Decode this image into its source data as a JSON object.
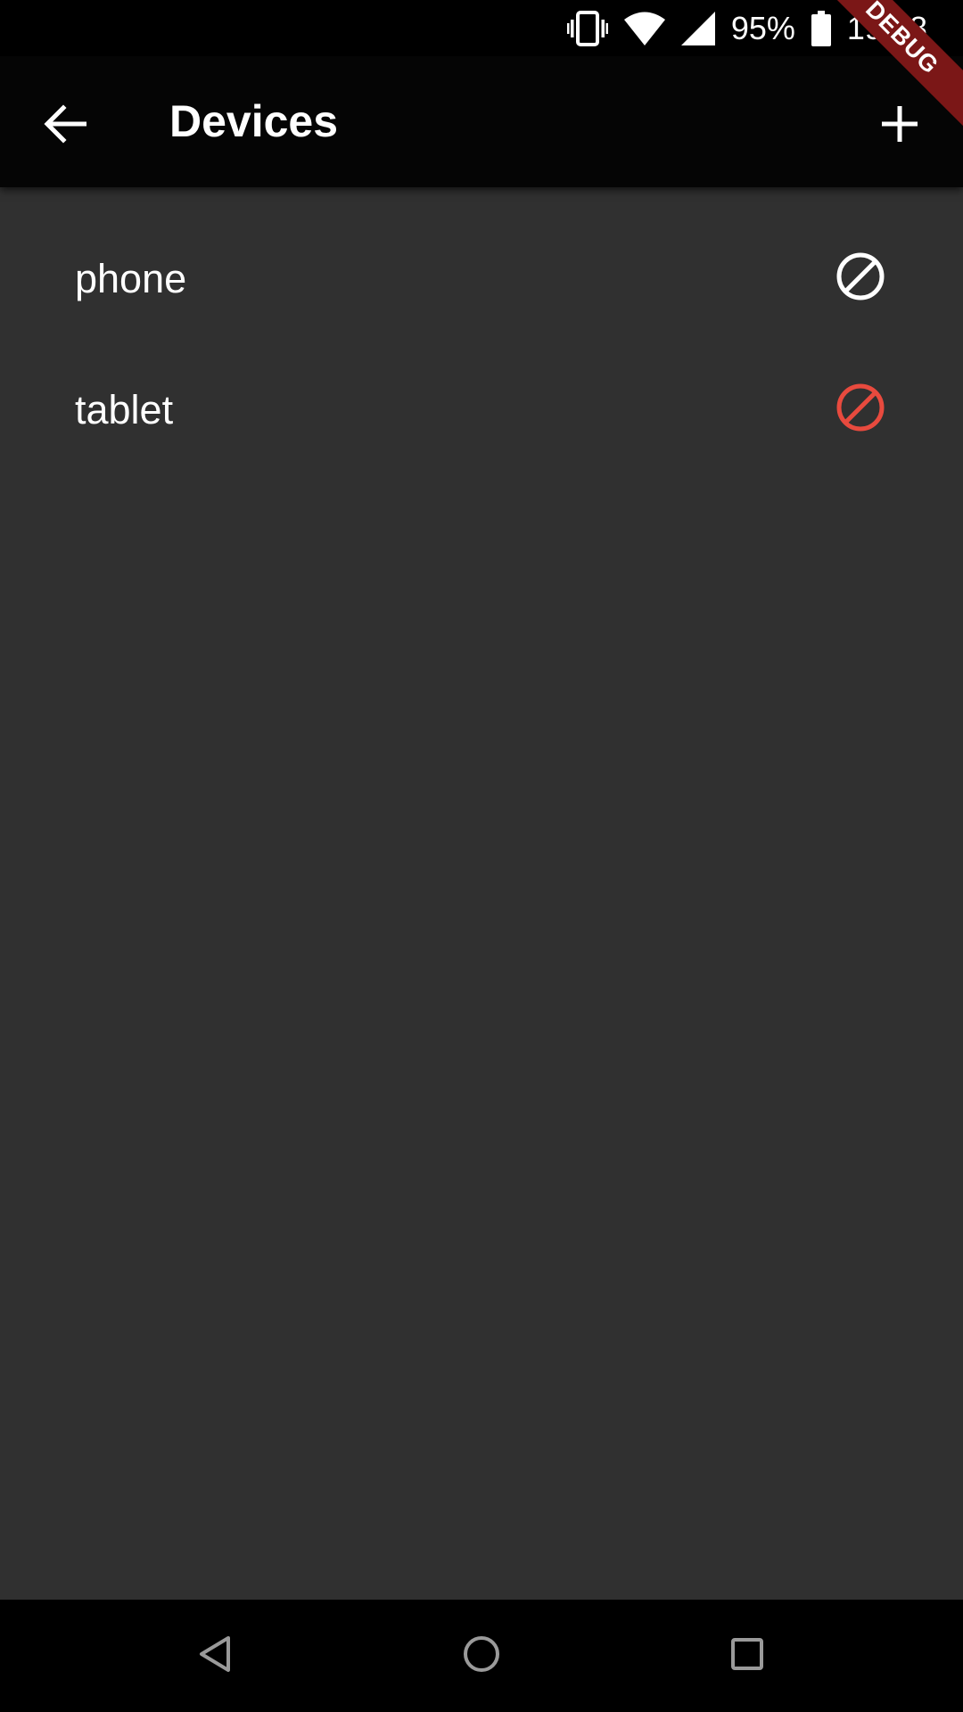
{
  "status_bar": {
    "battery": "95%",
    "time": "19:08",
    "icons": [
      "vibrate-icon",
      "wifi-icon",
      "cell-signal-icon",
      "battery-icon"
    ]
  },
  "debug_banner": "DEBUG",
  "app_bar": {
    "title": "Devices",
    "back_icon": "arrow-back-icon",
    "add_icon": "plus-icon"
  },
  "devices": [
    {
      "name": "phone",
      "status_icon": "block-icon",
      "icon_color": "#ffffff"
    },
    {
      "name": "tablet",
      "status_icon": "block-icon",
      "icon_color": "#e84a3e"
    }
  ],
  "nav_bar": {
    "icons": [
      "nav-back-icon",
      "nav-home-icon",
      "nav-recents-icon"
    ],
    "icon_color": "#9a9a9a"
  },
  "colors": {
    "background": "#303030",
    "app_bar": "#050505",
    "status_bar": "#000000",
    "text": "#ffffff",
    "blocked": "#e84a3e",
    "debug": "#7b1717"
  }
}
